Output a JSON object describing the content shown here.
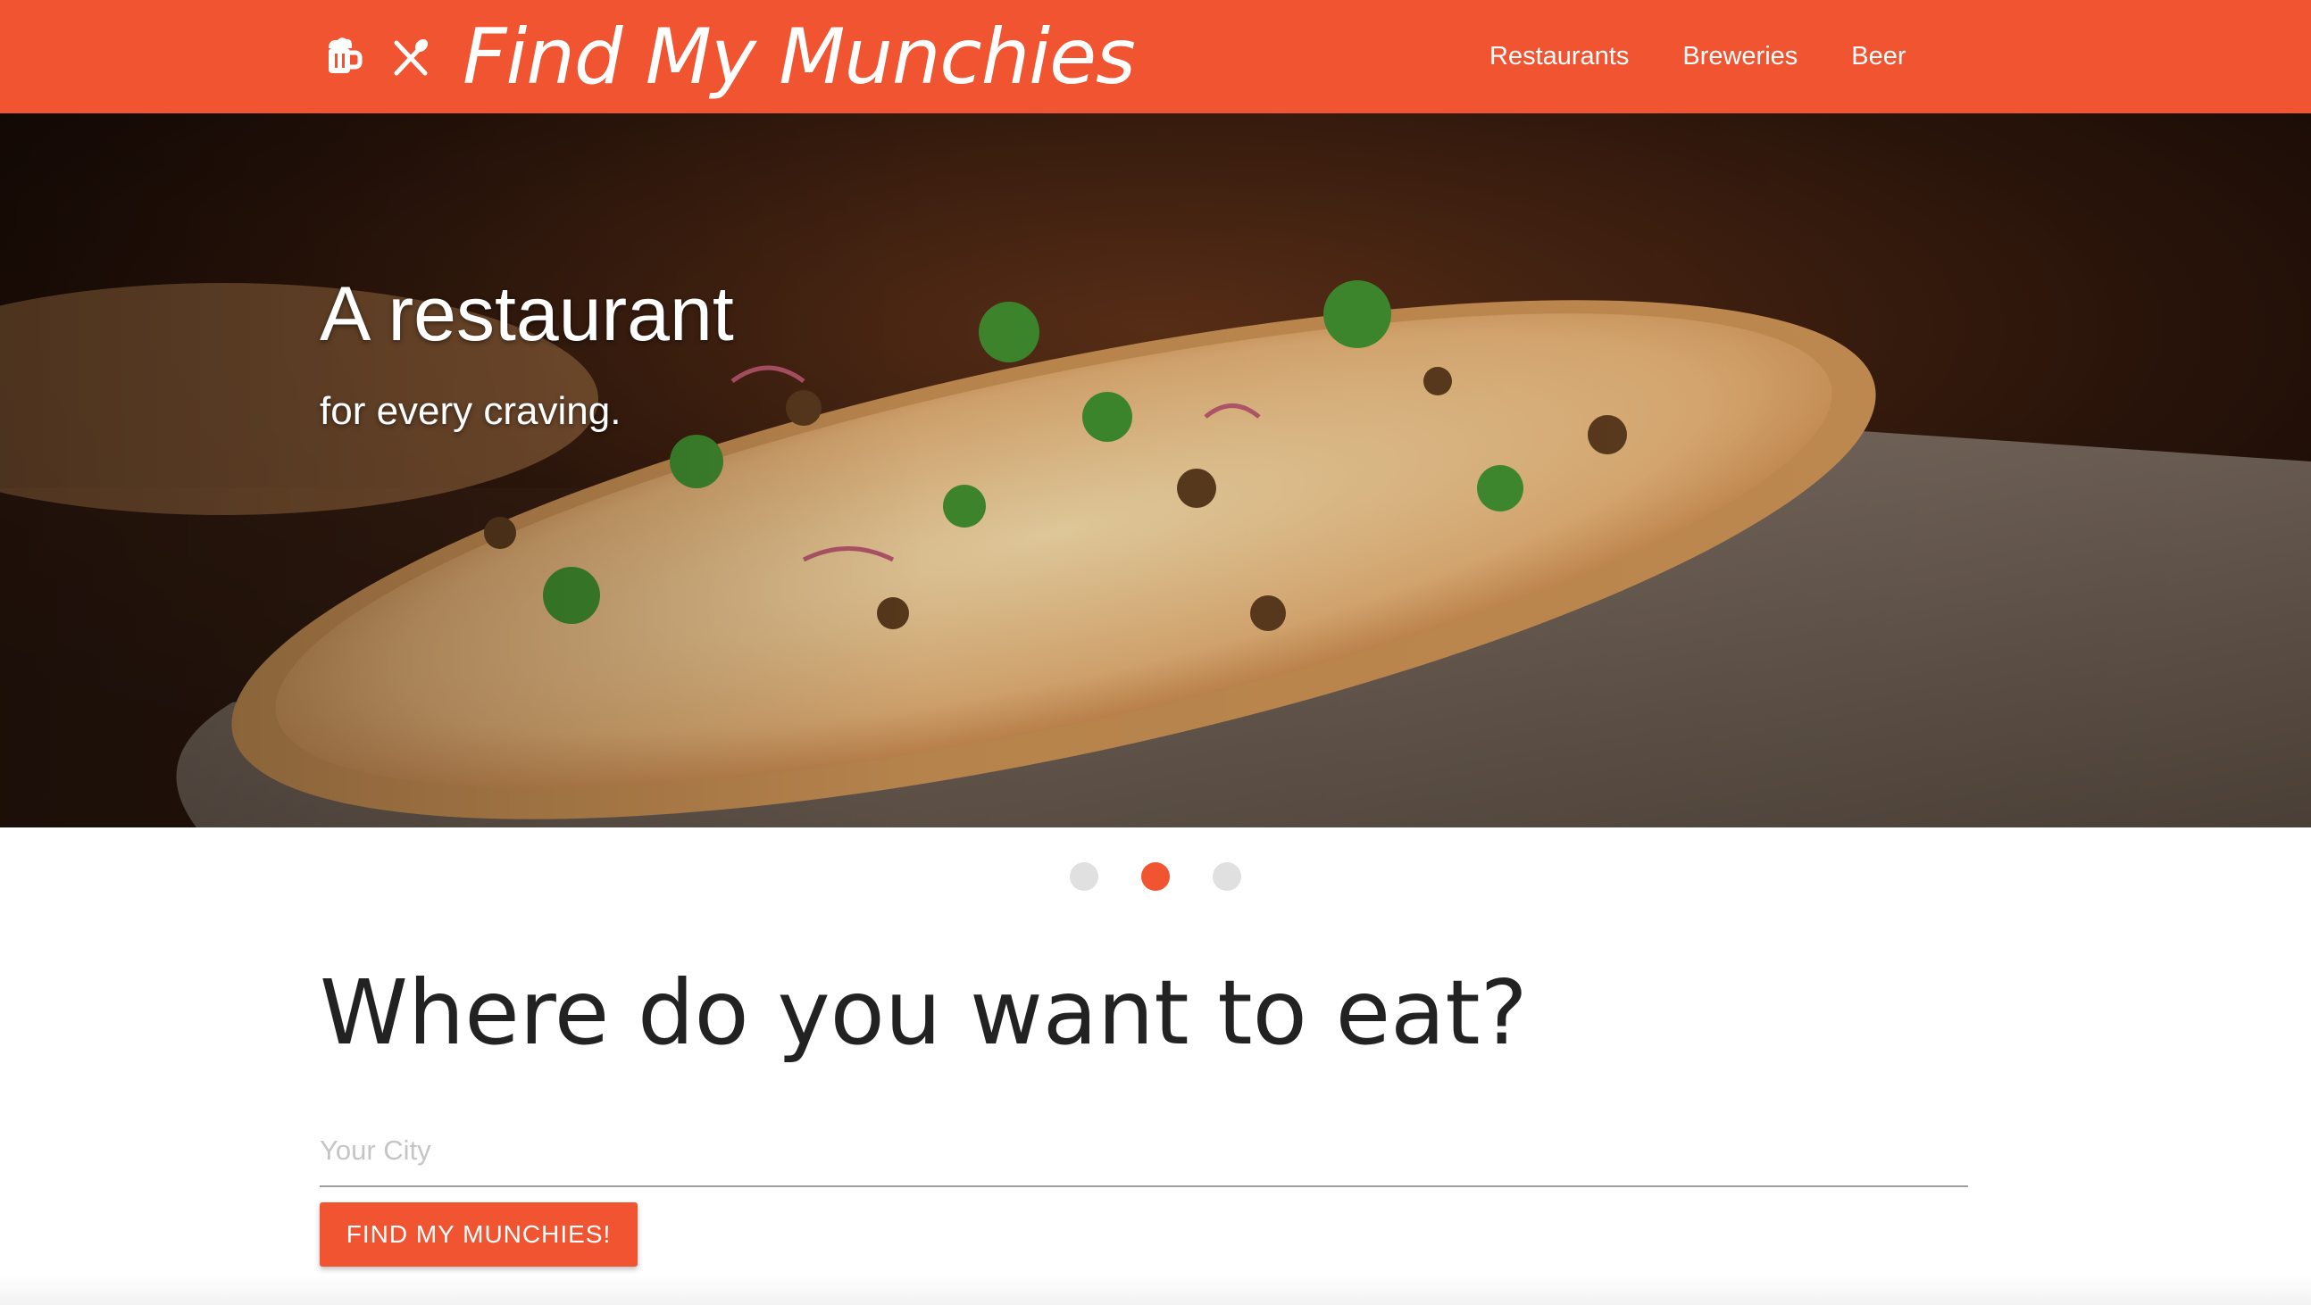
{
  "navbar": {
    "brand_title": "Find My Munchies",
    "brand_icons": [
      "beer-mug-icon",
      "fork-knife-icon"
    ],
    "links": [
      {
        "label": "Restaurants"
      },
      {
        "label": "Breweries"
      },
      {
        "label": "Beer"
      }
    ]
  },
  "hero": {
    "title": "A restaurant",
    "subtitle": "for every craving.",
    "image": "pizza-on-peel-photo"
  },
  "carousel": {
    "slide_count": 3,
    "active_index": 1
  },
  "search": {
    "heading": "Where do you want to eat?",
    "city_placeholder": "Your City",
    "city_value": "",
    "button_label": "FIND MY MUNCHIES!"
  },
  "colors": {
    "brand_orange": "#f15430",
    "heading_text": "#222222",
    "indicator_inactive": "#e0e0e0",
    "input_underline": "#9e9e9e",
    "placeholder_text": "#c5c5c5"
  }
}
